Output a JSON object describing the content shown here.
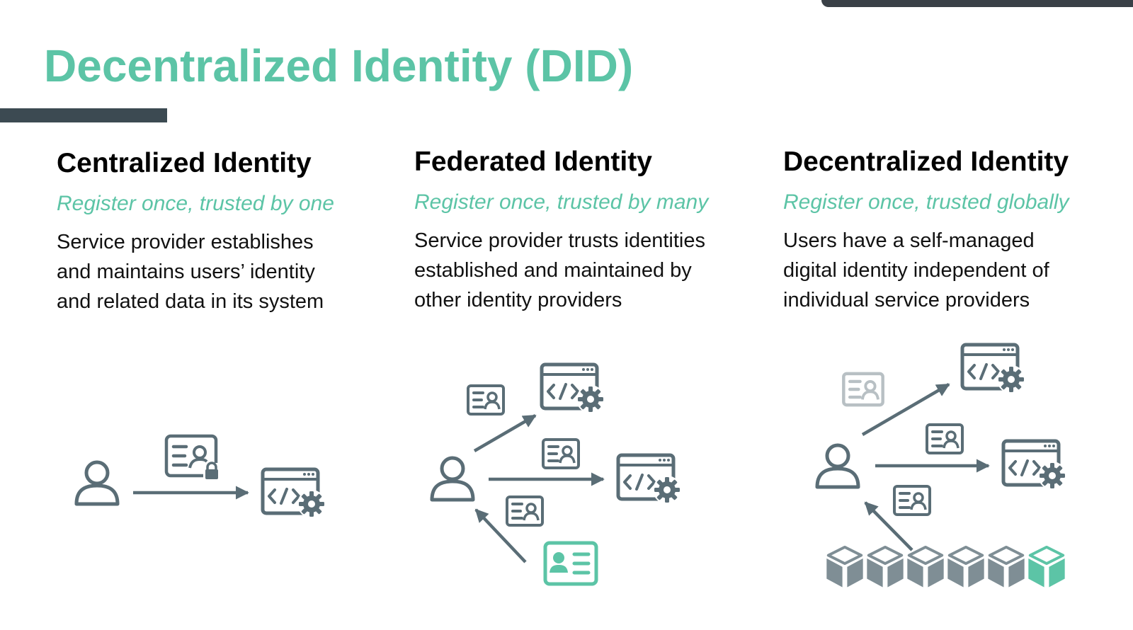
{
  "slide": {
    "title": "Decentralized Identity (DID)"
  },
  "columns": [
    {
      "heading": "Centralized Identity",
      "tagline": "Register once, trusted by one",
      "lines": [
        "Service provider establishes",
        "and maintains users’ identity",
        "and related data in its system"
      ]
    },
    {
      "heading": "Federated Identity",
      "tagline": "Register once, trusted by many",
      "lines": [
        "Service provider trusts identities",
        "established and maintained by",
        "other identity providers"
      ]
    },
    {
      "heading": "Decentralized Identity",
      "tagline": "Register once, trusted globally",
      "lines": [
        "Users have a self-managed",
        "digital identity independent of",
        "individual service providers"
      ]
    }
  ],
  "colors": {
    "accent": "#5cc4a6",
    "icon": "#5a6d76",
    "icon_light": "#b8c0c4",
    "bar": "#3c4a52"
  },
  "icons": [
    "user-icon",
    "id-card-icon",
    "locked-id-card-icon",
    "service-app-icon",
    "blockchain-block-icon"
  ]
}
